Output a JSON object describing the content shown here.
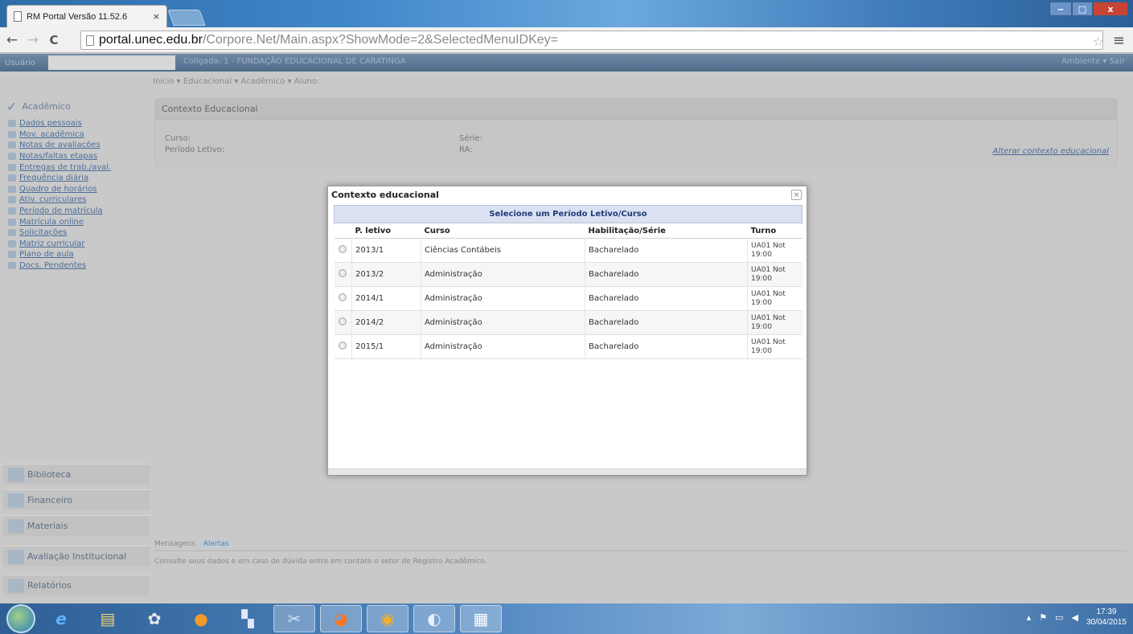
{
  "browser": {
    "tab_title": "RM Portal Versão 11.52.6",
    "tab_close": "×",
    "url_host": "portal.unec.edu.br",
    "url_path": "/Corpore.Net/Main.aspx?ShowMode=2&SelectedMenuIDKey=",
    "back_glyph": "←",
    "forward_glyph": "→",
    "reload_glyph": "C",
    "star_glyph": "☆",
    "menu_glyph": "≡",
    "win_min": "‒",
    "win_max": "□",
    "win_close": "x"
  },
  "portal": {
    "user_label": "Usuário",
    "coligada": "Coligada: 1 - FUNDAÇÃO EDUCACIONAL DE CARATINGA",
    "top_right": "Ambiente ▾  Sair",
    "breadcrumb": "Início ▾  Educacional ▾  Acadêmico ▾  Aluno:"
  },
  "sidebar": {
    "academico_label": "Acadêmico",
    "links": [
      "Dados pessoais",
      "Mov. acadêmica",
      "Notas de avaliações",
      "Notas/faltas etapas",
      "Entregas de trab./aval.",
      "Frequência diária",
      "Quadro de horários",
      "Ativ. curriculares",
      "Período de matrícula",
      "Matrícula online",
      "Solicitações",
      "Matriz curricular",
      "Plano de aula",
      "Docs. Pendentes"
    ],
    "modules": [
      "Biblioteca",
      "Financeiro",
      "Materiais",
      "Avaliação Institucional",
      "Relatórios"
    ]
  },
  "context_panel": {
    "title": "Contexto Educacional",
    "curso_label": "Curso:",
    "periodo_label": "Período Letivo:",
    "serie_label": "Série:",
    "ra_label": "RA:",
    "alterar_link": "Alterar contexto educacional"
  },
  "messages": {
    "tab_mensagens": "Mensagens",
    "tab_alertas": "Alertas",
    "text": "Consulte seus dados e em caso de dúvida entre em contato o setor de Registro Acadêmico."
  },
  "dialog": {
    "title": "Contexto educacional",
    "close": "×",
    "caption": "Selecione um Período Letivo/Curso",
    "headers": [
      "P. letivo",
      "Curso",
      "Habilitação/Série",
      "Turno"
    ],
    "rows": [
      {
        "periodo": "2013/1",
        "curso": "Ciências Contábeis",
        "habilitacao": "Bacharelado",
        "turno1": "UA01 Not",
        "turno2": "19:00"
      },
      {
        "periodo": "2013/2",
        "curso": "Administração",
        "habilitacao": "Bacharelado",
        "turno1": "UA01 Not",
        "turno2": "19:00"
      },
      {
        "periodo": "2014/1",
        "curso": "Administração",
        "habilitacao": "Bacharelado",
        "turno1": "UA01 Not",
        "turno2": "19:00"
      },
      {
        "periodo": "2014/2",
        "curso": "Administração",
        "habilitacao": "Bacharelado",
        "turno1": "UA01 Not",
        "turno2": "19:00"
      },
      {
        "periodo": "2015/1",
        "curso": "Administração",
        "habilitacao": "Bacharelado",
        "turno1": "UA01 Not",
        "turno2": "19:00"
      }
    ]
  },
  "taskbar": {
    "apps": [
      "ie-icon",
      "explorer-icon",
      "media-center-icon",
      "media-player-icon",
      "network-icon",
      "tools-icon",
      "firefox-icon",
      "chrome-icon",
      "itunes-icon",
      "word-icon"
    ],
    "tray_up": "▴",
    "time": "17:39",
    "date": "30/04/2015"
  }
}
